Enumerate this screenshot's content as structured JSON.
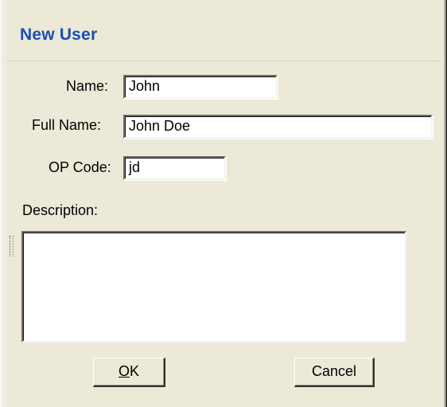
{
  "window": {
    "title": "New User"
  },
  "form": {
    "name_label": "Name:",
    "name_value": "John",
    "fullname_label": "Full Name:",
    "fullname_value": "John Doe",
    "opcode_label": "OP Code:",
    "opcode_value": "jd",
    "description_label": "Description:",
    "description_value": ""
  },
  "buttons": {
    "ok_mnemonic": "O",
    "ok_rest": "K",
    "cancel_label": "Cancel"
  }
}
